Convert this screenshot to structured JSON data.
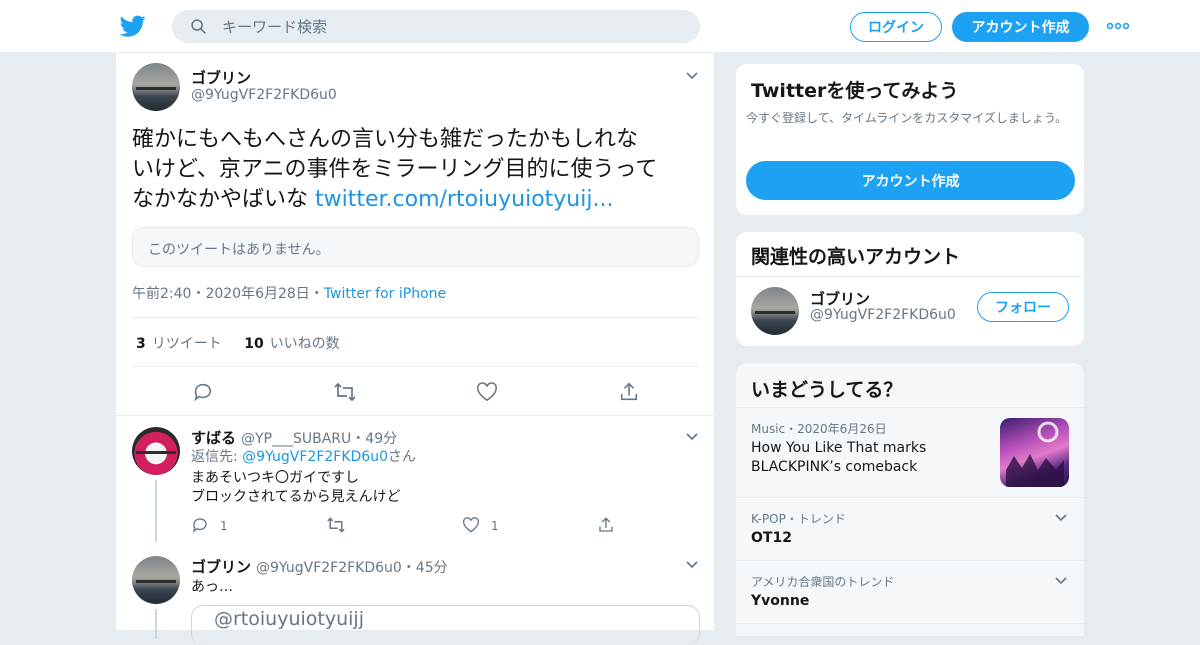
{
  "header": {
    "search_placeholder": "キーワード検索",
    "login_label": "ログイン",
    "signup_label": "アカウント作成"
  },
  "tweet": {
    "name": "ゴブリン",
    "handle": "@9YugVF2F2FKD6u0",
    "text_line1": "確かにもへもへさんの言い分も雑だったかもしれな",
    "text_line2": "いけど、京アニの事件をミラーリング目的に使うって",
    "text_line3": "なかなかやばいな ",
    "link": "twitter.com/rtoiuyuiotyuij...",
    "quote_missing": "このツイートはありません。",
    "time": "午前2:40・2020年6月28日・",
    "source": "Twitter for iPhone",
    "retweets": "3",
    "retweets_label": "リツイート",
    "likes": "10",
    "likes_label": "いいねの数"
  },
  "replies": [
    {
      "name": "すばる",
      "handle": "@YP___SUBARU・49分",
      "reply_to_prefix": "返信先: ",
      "reply_to_handle": "@9YugVF2F2FKD6u0",
      "reply_to_suffix": "さん",
      "line1": "まあそいつキ〇ガイですし",
      "line2": "ブロックされてるから見えんけど",
      "reply_count": "1",
      "like_count": "1"
    },
    {
      "name": "ゴブリン",
      "handle": "@9YugVF2F2FKD6u0・45分",
      "line1": "あっ…",
      "card_text": "@rtoiuyuiotyuijj"
    }
  ],
  "sidebar": {
    "signup_title": "Twitterを使ってみよう",
    "signup_desc": "今すぐ登録して、タイムラインをカスタマイズしましょう。",
    "signup_button": "アカウント作成",
    "related_title": "関連性の高いアカウント",
    "related_name": "ゴブリン",
    "related_handle": "@9YugVF2F2FKD6u0",
    "follow_label": "フォロー",
    "trends_title": "いまどうしてる？",
    "trends": [
      {
        "context": "Music・2020年6月26日",
        "line1": "How You Like That marks",
        "line2": "BLACKPINK’s comeback"
      },
      {
        "context": "K-POP・トレンド",
        "line1": "OT12"
      },
      {
        "context": "アメリカ合衆国のトレンド",
        "line1": "Yvonne"
      }
    ]
  },
  "colors": {
    "accent": "#1da1f2",
    "link": "#1b95e0",
    "background": "#e6ecf0"
  }
}
